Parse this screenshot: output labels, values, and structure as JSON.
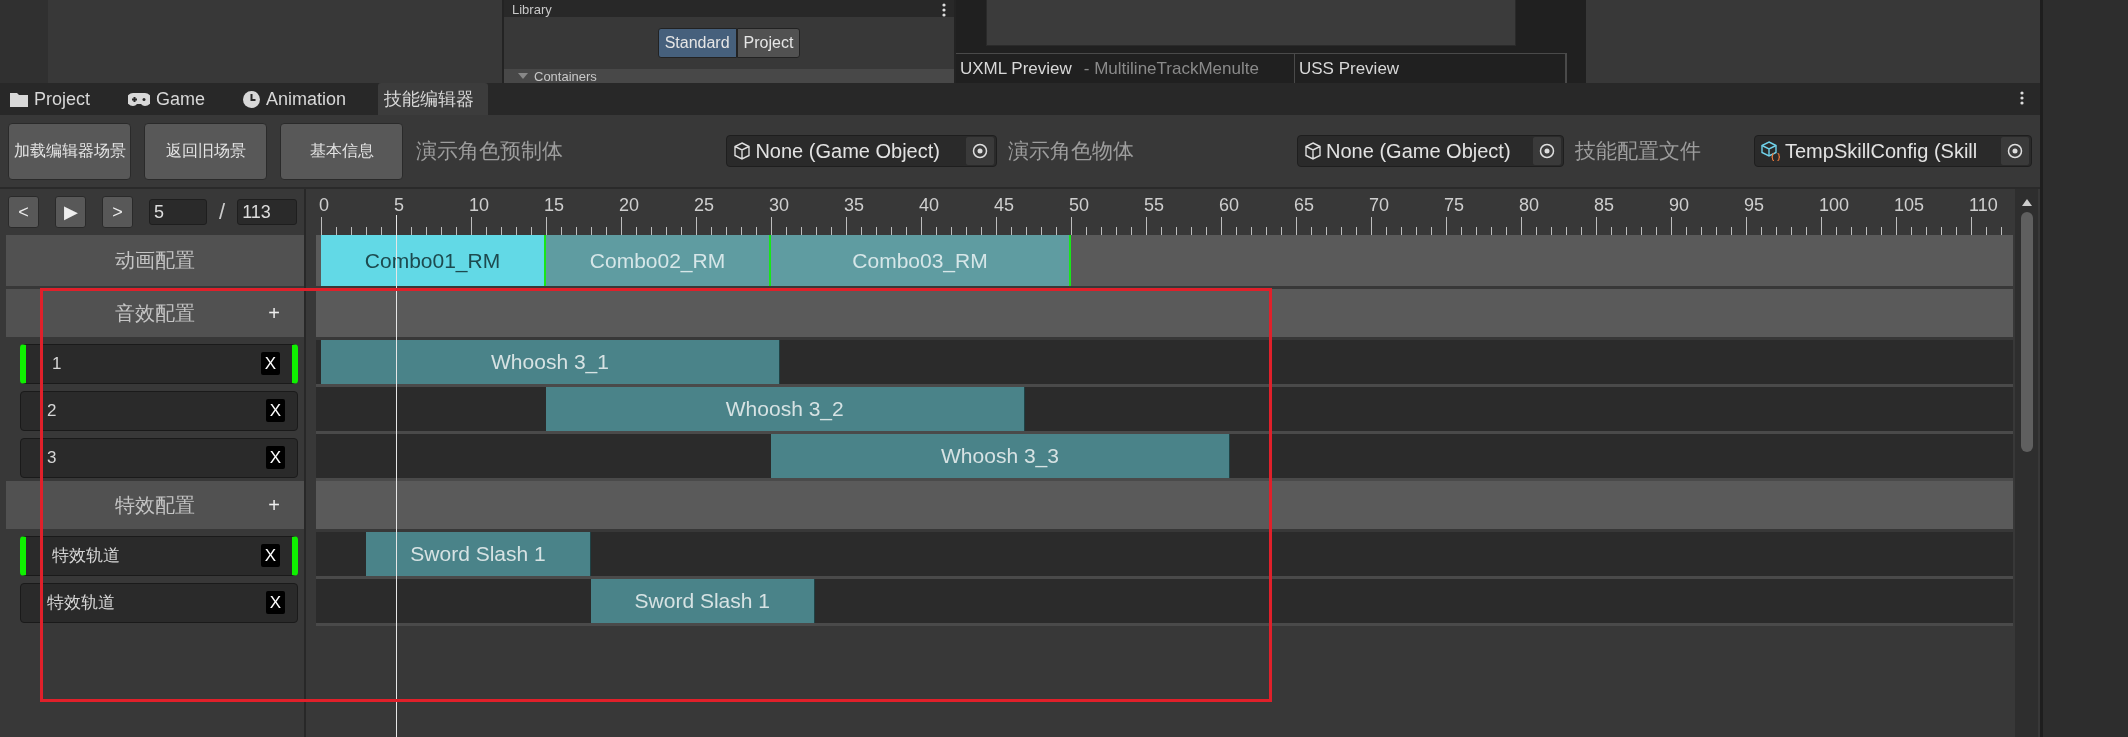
{
  "top": {
    "library_title": "Library",
    "toggle": [
      {
        "label": "Standard",
        "selected": true
      },
      {
        "label": "Project",
        "selected": false
      }
    ],
    "library_section": "Containers",
    "preview_tabs": [
      {
        "label": "UXML Preview",
        "subtitle": "- MultilineTrackMenulte"
      },
      {
        "label": "USS Preview"
      }
    ]
  },
  "tabs": [
    {
      "label": "Project",
      "selected": false
    },
    {
      "label": "Game",
      "selected": false
    },
    {
      "label": "Animation",
      "selected": false
    },
    {
      "label": "技能编辑器",
      "selected": true
    }
  ],
  "toolbar": {
    "buttons": [
      "加载编辑器场景",
      "返回旧场景",
      "基本信息"
    ],
    "fields": [
      {
        "label": "演示角色预制体",
        "value": "None (Game Object)",
        "kind": "object"
      },
      {
        "label": "演示角色物体",
        "value": "None (Game Object)",
        "kind": "object"
      },
      {
        "label": "技能配置文件",
        "value": "TempSkillConfig (Skill",
        "kind": "script"
      }
    ]
  },
  "playback": {
    "buttons": [
      "<",
      "▶",
      ">"
    ],
    "current_frame": "5",
    "separator": "/",
    "total_frames": "113"
  },
  "ruler": {
    "labels": [
      "0",
      "5",
      "10",
      "15",
      "20",
      "25",
      "30",
      "35",
      "40",
      "45",
      "50",
      "55",
      "60",
      "65",
      "70",
      "75",
      "80",
      "85",
      "90",
      "95",
      "100",
      "105",
      "110"
    ]
  },
  "sections": [
    {
      "kind": "animation",
      "label": "动画配置",
      "clips": [
        {
          "label": "Combo01_RM",
          "selected": true
        },
        {
          "label": "Combo02_RM",
          "selected": false
        },
        {
          "label": "Combo03_RM",
          "selected": false
        }
      ]
    },
    {
      "kind": "audio",
      "label": "音效配置",
      "add_button": "+",
      "tracks": [
        {
          "name": "1",
          "selected": true,
          "delete": "X",
          "clip": "Whoosh 3_1"
        },
        {
          "name": "2",
          "selected": false,
          "delete": "X",
          "clip": "Whoosh 3_2"
        },
        {
          "name": "3",
          "selected": false,
          "delete": "X",
          "clip": "Whoosh 3_3"
        }
      ]
    },
    {
      "kind": "effect",
      "label": "特效配置",
      "add_button": "+",
      "tracks": [
        {
          "name": "特效轨道",
          "selected": true,
          "delete": "X",
          "clip": "Sword Slash 1"
        },
        {
          "name": "特效轨道",
          "selected": false,
          "delete": "X",
          "clip": "Sword Slash 1"
        }
      ]
    }
  ]
}
